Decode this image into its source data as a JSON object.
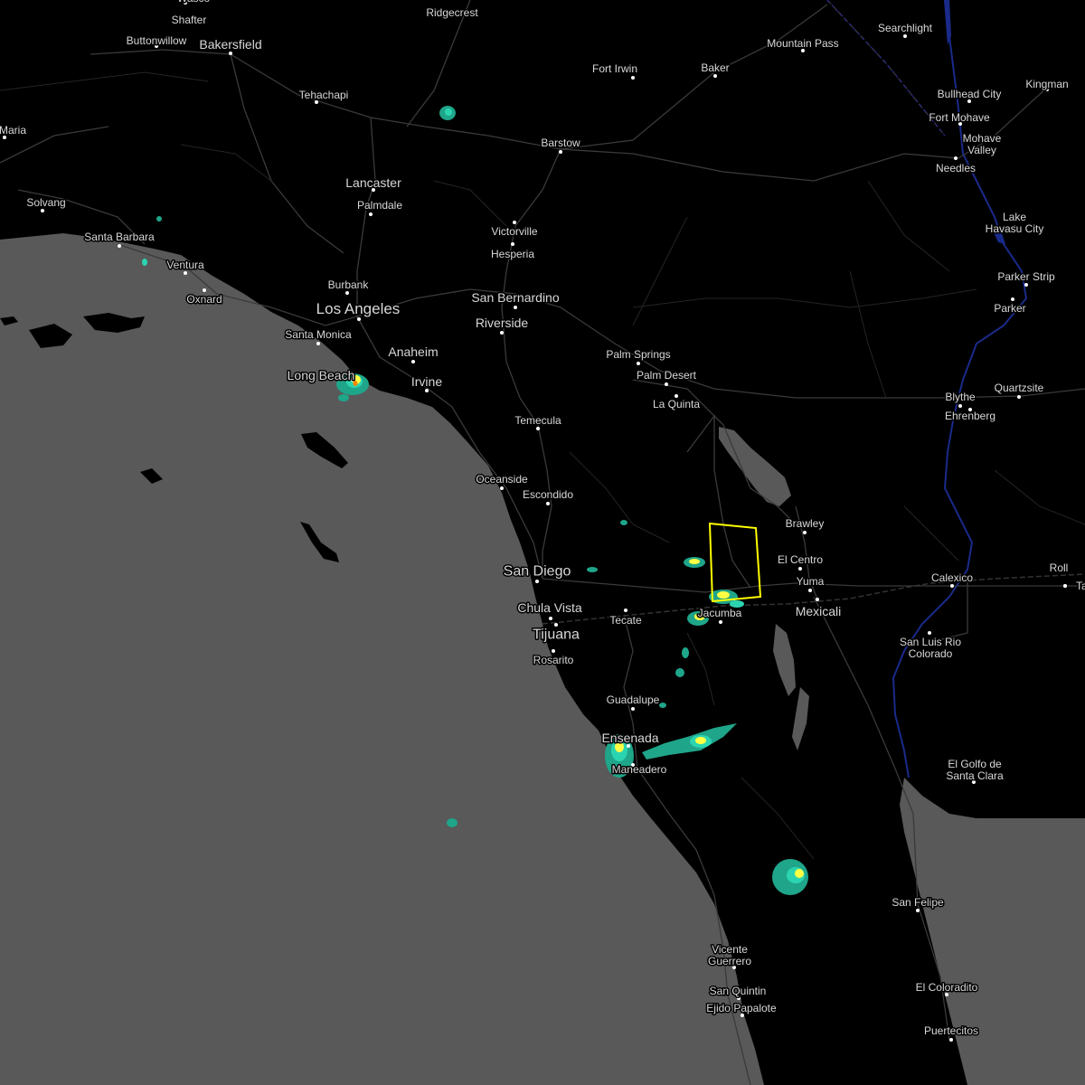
{
  "map": {
    "colors": {
      "ocean": "#595959",
      "land": "#000000",
      "roads": "#3a3a3a",
      "highways": "#555555",
      "border": "#333333",
      "river": "#1a2a8a",
      "labels": "#d8d8d8",
      "warning_polygon": "#ffff00",
      "radar_light": "#1fa58a",
      "radar_mid": "#2bd4b0",
      "radar_heavy": "#ffff44",
      "radar_core": "#ff8800"
    },
    "cities": [
      {
        "name": "Wasco"
      },
      {
        "name": "Shafter"
      },
      {
        "name": "Buttonwillow"
      },
      {
        "name": "Bakersfield"
      },
      {
        "name": "Ridgecrest"
      },
      {
        "name": "Searchlight"
      },
      {
        "name": "Mountain Pass"
      },
      {
        "name": "Fort Irwin"
      },
      {
        "name": "Baker"
      },
      {
        "name": "Kingman"
      },
      {
        "name": "Bullhead City"
      },
      {
        "name": "Fort Mohave"
      },
      {
        "name": "Mohave Valley"
      },
      {
        "name": "Needles"
      },
      {
        "name": "Tehachapi"
      },
      {
        "name": "Maria"
      },
      {
        "name": "Barstow"
      },
      {
        "name": "Lancaster"
      },
      {
        "name": "Palmdale"
      },
      {
        "name": "Solvang"
      },
      {
        "name": "Victorville"
      },
      {
        "name": "Hesperia"
      },
      {
        "name": "Santa Barbara"
      },
      {
        "name": "Lake Havasu City"
      },
      {
        "name": "Ventura"
      },
      {
        "name": "Oxnard"
      },
      {
        "name": "Burbank"
      },
      {
        "name": "San Bernardino"
      },
      {
        "name": "Parker Strip"
      },
      {
        "name": "Los Angeles"
      },
      {
        "name": "Parker"
      },
      {
        "name": "Riverside"
      },
      {
        "name": "Santa Monica"
      },
      {
        "name": "Anaheim"
      },
      {
        "name": "Palm Springs"
      },
      {
        "name": "Palm Desert"
      },
      {
        "name": "Long Beach"
      },
      {
        "name": "Irvine"
      },
      {
        "name": "Quartzsite"
      },
      {
        "name": "La Quinta"
      },
      {
        "name": "Blythe"
      },
      {
        "name": "Ehrenberg"
      },
      {
        "name": "Temecula"
      },
      {
        "name": "Oceanside"
      },
      {
        "name": "Escondido"
      },
      {
        "name": "Brawley"
      },
      {
        "name": "El Centro"
      },
      {
        "name": "Roll"
      },
      {
        "name": "Tacna"
      },
      {
        "name": "San Diego"
      },
      {
        "name": "Calexico"
      },
      {
        "name": "Yuma"
      },
      {
        "name": "Chula Vista"
      },
      {
        "name": "Jacumba"
      },
      {
        "name": "Mexicali"
      },
      {
        "name": "Tecate"
      },
      {
        "name": "Tijuana"
      },
      {
        "name": "San Luis Rio Colorado"
      },
      {
        "name": "Rosarito"
      },
      {
        "name": "Guadalupe"
      },
      {
        "name": "Ensenada"
      },
      {
        "name": "Maneadero"
      },
      {
        "name": "El Golfo de Santa Clara"
      },
      {
        "name": "San Felipe"
      },
      {
        "name": "Vicente Guerrero"
      },
      {
        "name": "San Quintin"
      },
      {
        "name": "Ejido Papalote"
      },
      {
        "name": "El Coloradito"
      },
      {
        "name": "Puertecitos"
      }
    ],
    "warning_polygon": {
      "type": "severe thunderstorm warning"
    }
  }
}
